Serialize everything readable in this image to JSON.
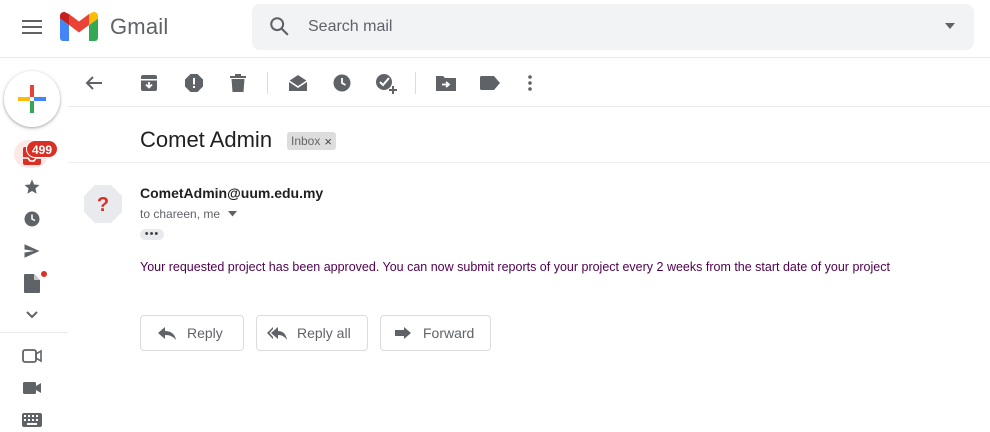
{
  "app": {
    "name": "Gmail"
  },
  "search": {
    "placeholder": "Search mail"
  },
  "rail": {
    "inbox_badge": "499"
  },
  "email": {
    "subject": "Comet Admin",
    "label": "Inbox",
    "label_close": "×",
    "sender": "CometAdmin@uum.edu.my",
    "recipients": "to chareen, me",
    "ellipsis": "•••",
    "body": "Your requested project has been approved. You can now submit reports of your project every 2 weeks from the start date of your project"
  },
  "actions": {
    "reply": "Reply",
    "reply_all": "Reply all",
    "forward": "Forward"
  },
  "icons": {
    "menu": "menu-icon",
    "search": "search-icon",
    "dropdown": "chevron-down-icon",
    "back": "arrow-left-icon",
    "archive": "archive-icon",
    "spam": "report-spam-icon",
    "delete": "trash-icon",
    "mark_unread": "mark-unread-icon",
    "snooze": "clock-icon",
    "add_task": "add-task-icon",
    "move": "move-to-icon",
    "labels": "label-icon",
    "more": "more-vert-icon"
  },
  "colors": {
    "badge": "#d93025",
    "body_text": "#500050",
    "search_bg": "#f1f3f4"
  }
}
